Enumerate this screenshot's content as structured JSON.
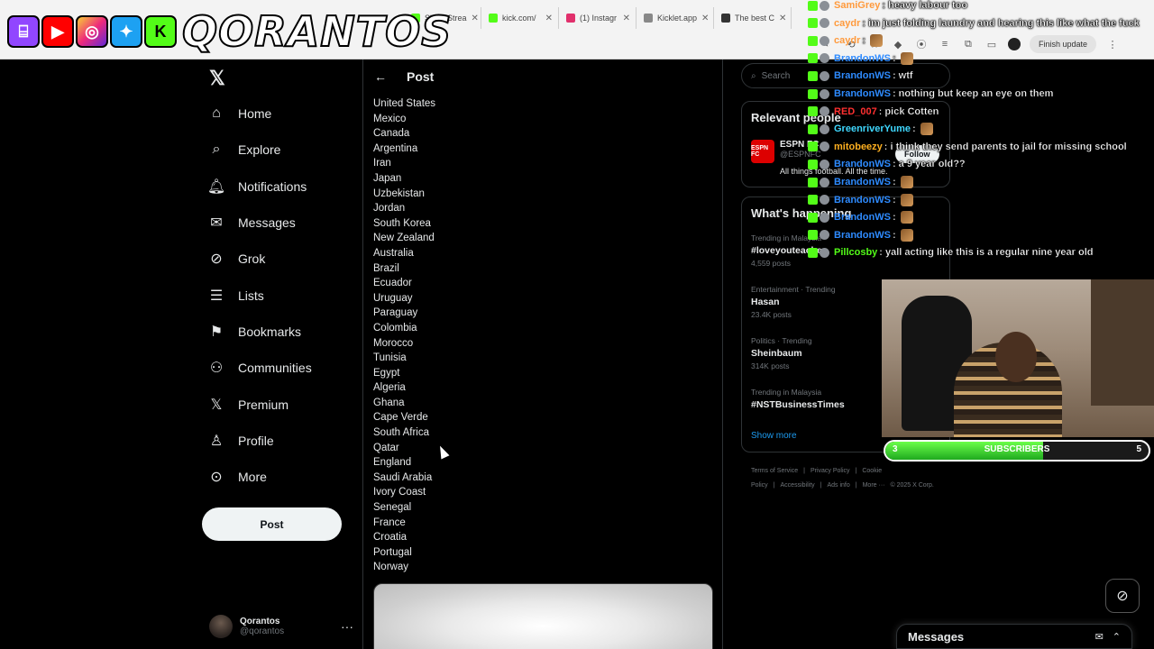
{
  "browser": {
    "tabs": [
      {
        "label": "Sliker Strea",
        "color": "#53fc18"
      },
      {
        "label": "kick.com/",
        "color": "#53fc18"
      },
      {
        "label": "(1) Instagr",
        "color": "#e1306c"
      },
      {
        "label": "Kicklet.app",
        "color": "#888888"
      },
      {
        "label": "The best C",
        "color": "#333333"
      }
    ],
    "finish_update": "Finish update"
  },
  "banner": {
    "name": "QORANTOS"
  },
  "nav": {
    "items": [
      {
        "label": "Home",
        "icon": "home-icon"
      },
      {
        "label": "Explore",
        "icon": "search-icon"
      },
      {
        "label": "Notifications",
        "icon": "bell-icon"
      },
      {
        "label": "Messages",
        "icon": "mail-icon"
      },
      {
        "label": "Grok",
        "icon": "grok-icon"
      },
      {
        "label": "Lists",
        "icon": "list-icon"
      },
      {
        "label": "Bookmarks",
        "icon": "bookmark-icon"
      },
      {
        "label": "Communities",
        "icon": "communities-icon"
      },
      {
        "label": "Premium",
        "icon": "x-icon"
      },
      {
        "label": "Profile",
        "icon": "person-icon"
      },
      {
        "label": "More",
        "icon": "more-circle-icon"
      }
    ],
    "post_button": "Post"
  },
  "account": {
    "display_name": "Qorantos",
    "handle": "@qorantos",
    "more": "···"
  },
  "post": {
    "title": "Post",
    "countries": [
      "United States",
      "Mexico",
      "Canada",
      "Argentina",
      "Iran",
      "Japan",
      "Uzbekistan",
      "Jordan",
      "South Korea",
      "New Zealand",
      "Australia",
      "Brazil",
      "Ecuador",
      "Uruguay",
      "Paraguay",
      "Colombia",
      "Morocco",
      "Tunisia",
      "Egypt",
      "Algeria",
      "Ghana",
      "Cape Verde",
      "South Africa",
      "Qatar",
      "England",
      "Saudi Arabia",
      "Ivory Coast",
      "Senegal",
      "France",
      "Croatia",
      "Portugal",
      "Norway"
    ]
  },
  "right": {
    "search_placeholder": "Search",
    "relevant_title": "Relevant people",
    "relevant": {
      "name": "ESPN FC",
      "handle": "@ESPNFC",
      "bio": "All things football. All the time.",
      "follow": "Follow"
    },
    "happening_title": "What's happening",
    "trends": [
      {
        "context": "Trending in Malaysia",
        "topic": "#loveyouteacher",
        "count": "4,559 posts"
      },
      {
        "context": "Entertainment · Trending",
        "topic": "Hasan",
        "count": "23.4K posts"
      },
      {
        "context": "Politics · Trending",
        "topic": "Sheinbaum",
        "count": "314K posts"
      },
      {
        "context": "Trending in Malaysia",
        "topic": "#NSTBusinessTimes",
        "count": ""
      }
    ],
    "show_more": "Show more",
    "footer": [
      "Terms of Service",
      "|",
      "Privacy Policy",
      "|",
      "Cookie Policy",
      "|",
      "Accessibility",
      "|",
      "Ads info",
      "|",
      "More ···",
      "© 2025 X Corp."
    ]
  },
  "chat": [
    {
      "user": "SamiGrey",
      "color": "#ff9a3c",
      "text": ": heavy labour too",
      "emote": false
    },
    {
      "user": "caydr",
      "color": "#ff9a3c",
      "text": ": im just folding laundry and hearing this like what the fuck",
      "emote": false
    },
    {
      "user": "caydr",
      "color": "#ff9a3c",
      "text": ":",
      "emote": true
    },
    {
      "user": "BrandonWS",
      "color": "#2e8bff",
      "text": ":",
      "emote": true
    },
    {
      "user": "BrandonWS",
      "color": "#2e8bff",
      "text": ": wtf",
      "emote": false
    },
    {
      "user": "BrandonWS",
      "color": "#2e8bff",
      "text": ": nothing but keep an eye on them",
      "emote": false
    },
    {
      "user": "RED_007",
      "color": "#ff3030",
      "text": ": pick Cotten",
      "emote": false
    },
    {
      "user": "GreenriverYume",
      "color": "#3fd8ff",
      "text": ":",
      "emote": true
    },
    {
      "user": "mitobeezy",
      "color": "#ffb020",
      "text": ": i think they send parents to jail for missing school",
      "emote": false
    },
    {
      "user": "BrandonWS",
      "color": "#2e8bff",
      "text": ": a 9 year old??",
      "emote": false
    },
    {
      "user": "BrandonWS",
      "color": "#2e8bff",
      "text": ":",
      "emote": true
    },
    {
      "user": "BrandonWS",
      "color": "#2e8bff",
      "text": ":",
      "emote": true
    },
    {
      "user": "BrandonWS",
      "color": "#2e8bff",
      "text": ":",
      "emote": true
    },
    {
      "user": "BrandonWS",
      "color": "#2e8bff",
      "text": ":",
      "emote": true
    },
    {
      "user": "Pillcosby",
      "color": "#53fc18",
      "text": ": yall acting like this is a regular nine year old",
      "emote": false
    }
  ],
  "subgoal": {
    "current": "3",
    "label": "SUBSCRIBERS",
    "goal": "5",
    "progress_fraction": 0.6
  },
  "messages_drawer": {
    "title": "Messages"
  }
}
